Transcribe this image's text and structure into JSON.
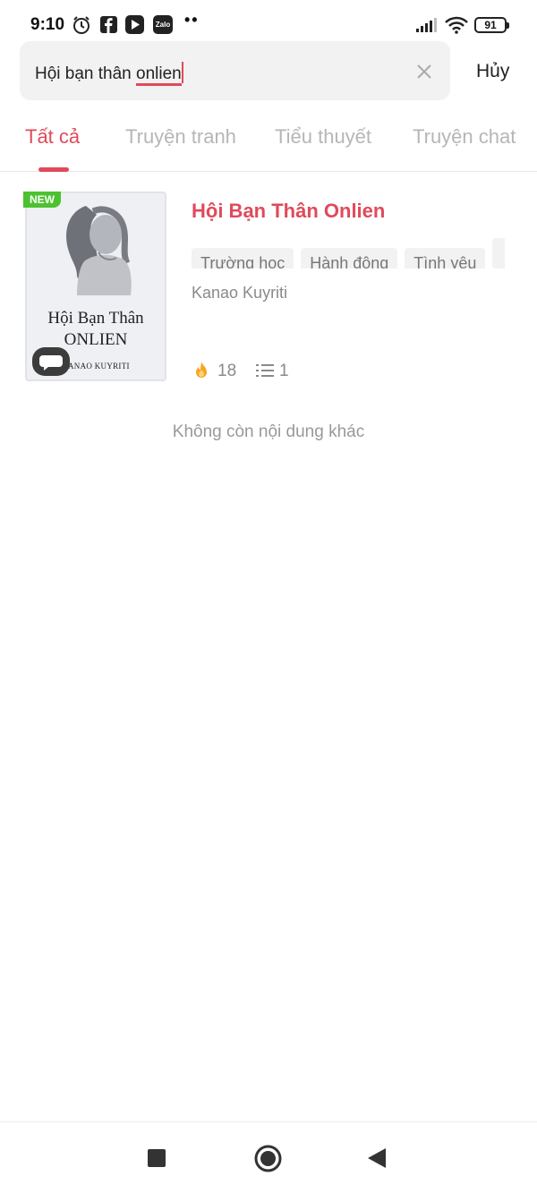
{
  "status_bar": {
    "time": "9:10",
    "battery": "91",
    "notification_icons": [
      "alarm-icon",
      "facebook-icon",
      "play-icon",
      "zalo-icon"
    ],
    "zalo_label": "Zalo",
    "more": "••"
  },
  "search": {
    "prefix": "Hội bạn thân ",
    "suffix": "onlien",
    "cancel_label": "Hủy"
  },
  "tabs": [
    {
      "label": "Tất cả",
      "active": true
    },
    {
      "label": "Truyện tranh",
      "active": false
    },
    {
      "label": "Tiểu thuyết",
      "active": false
    },
    {
      "label": "Truyện chat",
      "active": false
    }
  ],
  "result": {
    "badge": "NEW",
    "cover_title_line1": "Hội Bạn Thân",
    "cover_title_line2": "ONLIEN",
    "cover_author": "KANAO KUYRITI",
    "title": "Hội Bạn Thân Onlien",
    "tags": [
      "Trường học",
      "Hành động",
      "Tình yêu",
      ""
    ],
    "author": "Kanao Kuyriti",
    "views": "18",
    "chapters": "1"
  },
  "footer_text": "Không còn nội dung khác",
  "colors": {
    "accent": "#e04a5a",
    "new_badge": "#4cc230",
    "inactive_tab": "#b6b6b6"
  }
}
